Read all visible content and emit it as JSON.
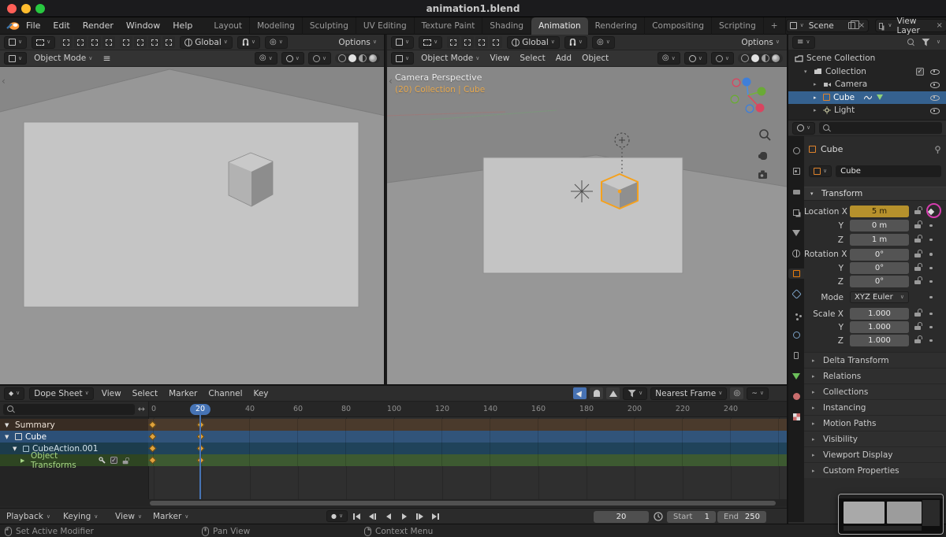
{
  "window": {
    "title": "animation1.blend"
  },
  "icons": {
    "chevron_down": "∨",
    "tri_down": "▼",
    "tri_right": "▶",
    "tri_down_sm": "▾",
    "tri_right_sm": "▸",
    "hamburger": "≡",
    "close": "×",
    "plus": "+",
    "arrow_lr": "↔",
    "check": "✓",
    "prop_circle": "◎",
    "record_dot": "●",
    "diamond": "◆",
    "collapse_left": "‹"
  },
  "menubar": {
    "app_menus": [
      "File",
      "Edit",
      "Render",
      "Window",
      "Help"
    ],
    "workspaces": [
      "Layout",
      "Modeling",
      "Sculpting",
      "UV Editing",
      "Texture Paint",
      "Shading",
      "Animation",
      "Rendering",
      "Compositing",
      "Scripting"
    ],
    "active_workspace": "Animation",
    "add_workspace": "+",
    "scene_selector": {
      "value": "Scene"
    },
    "view_layer_selector": {
      "value": "View Layer"
    }
  },
  "viewport_left": {
    "toolbar": {
      "orientation": "Global",
      "options": "Options"
    },
    "header": {
      "mode": "Object Mode"
    }
  },
  "viewport_right": {
    "toolbar": {
      "orientation": "Global",
      "options": "Options"
    },
    "header": {
      "mode": "Object Mode",
      "menus": [
        "View",
        "Select",
        "Add",
        "Object"
      ]
    },
    "overlay": {
      "line1": "Camera Perspective",
      "line2": "(20) Collection | Cube"
    }
  },
  "outliner": {
    "rows": [
      {
        "label": "Scene Collection"
      },
      {
        "label": "Collection"
      },
      {
        "label": "Camera"
      },
      {
        "label": "Cube"
      },
      {
        "label": "Light"
      }
    ],
    "selected_row": "Cube"
  },
  "properties": {
    "breadcrumb": "Cube",
    "name_field": "Cube",
    "tabs": [
      "tool-icon",
      "render-icon",
      "output-icon",
      "view-layer-icon",
      "scene-icon",
      "world-icon",
      "object-icon",
      "modifiers-icon",
      "particles-icon",
      "physics-icon",
      "constraints-icon",
      "object-data-icon",
      "material-icon",
      "texture-icon"
    ],
    "active_tab": "object-icon",
    "transform": {
      "title": "Transform",
      "rows": [
        {
          "label": "Location X",
          "value": "5 m",
          "keyframed": true
        },
        {
          "label": "Y",
          "value": "0 m",
          "keyframed": false
        },
        {
          "label": "Z",
          "value": "1 m",
          "keyframed": false
        },
        {
          "label": "Rotation X",
          "value": "0°",
          "keyframed": false
        },
        {
          "label": "Y",
          "value": "0°",
          "keyframed": false
        },
        {
          "label": "Z",
          "value": "0°",
          "keyframed": false
        }
      ],
      "mode_label": "Mode",
      "mode_value": "XYZ Euler",
      "scale_rows": [
        {
          "label": "Scale X",
          "value": "1.000"
        },
        {
          "label": "Y",
          "value": "1.000"
        },
        {
          "label": "Z",
          "value": "1.000"
        }
      ]
    },
    "panels": [
      "Delta Transform",
      "Relations",
      "Collections",
      "Instancing",
      "Motion Paths",
      "Visibility",
      "Viewport Display",
      "Custom Properties"
    ]
  },
  "dope_sheet": {
    "editor_label": "Dope Sheet",
    "menus": [
      "View",
      "Select",
      "Marker",
      "Channel",
      "Key"
    ],
    "snap_mode": "Nearest Frame",
    "ruler_ticks": [
      "0",
      "20",
      "40",
      "60",
      "80",
      "100",
      "120",
      "140",
      "160",
      "180",
      "200",
      "220",
      "240"
    ],
    "current_frame": "20",
    "channels": [
      {
        "label": "Summary"
      },
      {
        "label": "Cube"
      },
      {
        "label": "CubeAction.001"
      },
      {
        "label": "Object Transforms"
      }
    ],
    "keyframe_frames": [
      0,
      20
    ]
  },
  "timeline_footer": {
    "menus": [
      "Playback",
      "Keying",
      "View",
      "Marker"
    ],
    "frame": "20",
    "start_label": "Start",
    "start_value": "1",
    "end_label": "End",
    "end_value": "250"
  },
  "status_bar": {
    "hints": [
      "Set Active Modifier",
      "Pan View",
      "Context Menu"
    ]
  },
  "colors": {
    "selection_blue": "#35618f",
    "keyframed_field": "#b6912c",
    "object_orange": "#e87d0d",
    "playhead_blue": "#4673b4",
    "annotation_pink": "#d53cae"
  }
}
